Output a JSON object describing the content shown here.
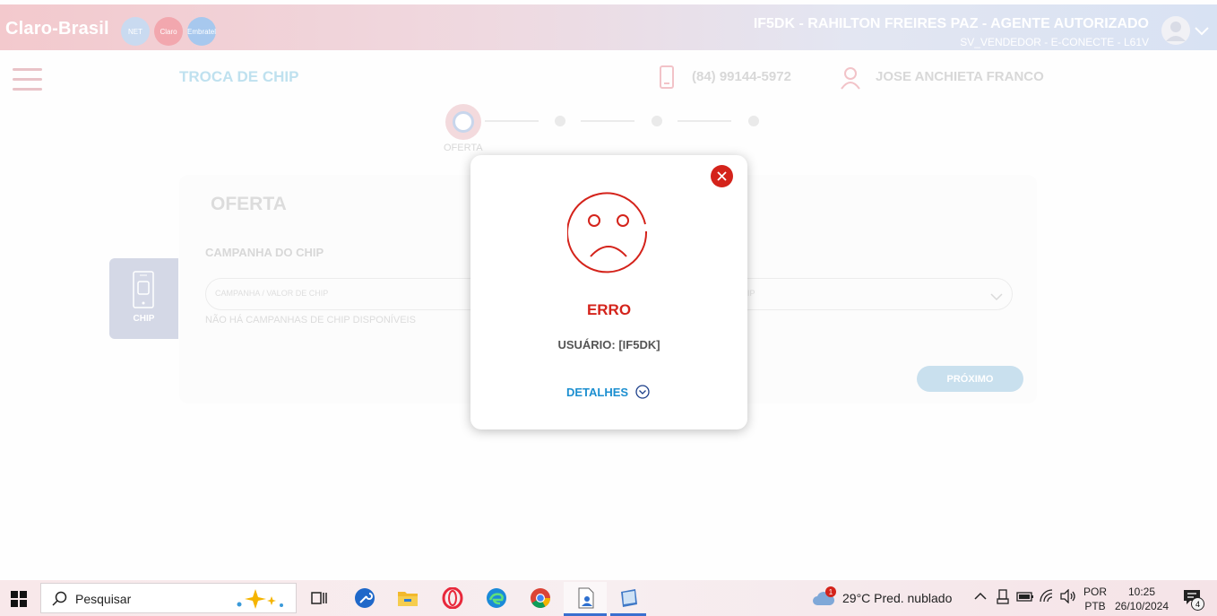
{
  "header": {
    "logo_text": "Claro-Brasil",
    "brands": [
      "NET",
      "Claro",
      "Embratel"
    ],
    "agent_name": "IF5DK - RAHILTON FREIRES PAZ - AGENTE AUTORIZADO",
    "agent_sub": "SV_VENDEDOR - E-CONECTE - L61V"
  },
  "subheader": {
    "page_title": "TROCA DE CHIP",
    "phone": "(84) 99144-5972",
    "client_name": "JOSE ANCHIETA FRANCO"
  },
  "stepper": {
    "active_label": "OFERTA"
  },
  "card": {
    "side_tab_label": "CHIP",
    "title": "OFERTA",
    "field_label": "CAMPANHA DO CHIP",
    "select1_placeholder": "CAMPANHA / VALOR DE CHIP",
    "select2_placeholder": "CHIP",
    "hint": "NÃO HÁ CAMPANHAS DE CHIP DISPONÍVEIS",
    "next_label": "PRÓXIMO"
  },
  "modal": {
    "title": "ERRO",
    "user": "USUÁRIO: [IF5DK]",
    "details_label": "DETALHES"
  },
  "taskbar": {
    "search_placeholder": "Pesquisar",
    "weather_badge": "1",
    "weather": "29°C  Pred. nublado",
    "lang_top": "POR",
    "lang_bottom": "PTB",
    "time": "10:25",
    "date": "26/10/2024",
    "notifications": "4"
  },
  "colors": {
    "error_red": "#d4231b",
    "link_blue": "#1c8fd0"
  }
}
